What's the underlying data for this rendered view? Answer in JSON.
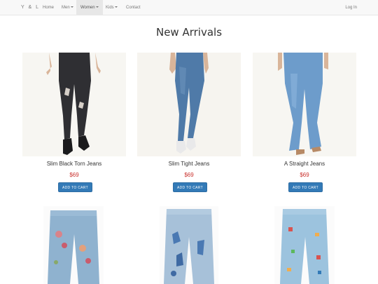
{
  "nav": {
    "brand": "Y & L",
    "items": [
      {
        "label": "Home",
        "dropdown": false,
        "active": false
      },
      {
        "label": "Men",
        "dropdown": true,
        "active": false
      },
      {
        "label": "Women",
        "dropdown": true,
        "active": true
      },
      {
        "label": "Kids",
        "dropdown": true,
        "active": false
      },
      {
        "label": "Contact",
        "dropdown": false,
        "active": false
      }
    ],
    "login": "Log In"
  },
  "page_title": "New Arrivals",
  "products": [
    {
      "name": "Slim Black Torn Jeans",
      "price": "$69",
      "button": "ADD TO CART",
      "denim_color": "#2f2f33"
    },
    {
      "name": "Slim Tight Jeans",
      "price": "$69",
      "button": "ADD TO CART",
      "denim_color": "#4f7aa8"
    },
    {
      "name": "A Straight Jeans",
      "price": "$69",
      "button": "ADD TO CART",
      "denim_color": "#6d9ccb"
    }
  ],
  "colors": {
    "accent_button": "#337ab7",
    "price": "#c9302c",
    "navbar_bg": "#f8f8f8"
  }
}
